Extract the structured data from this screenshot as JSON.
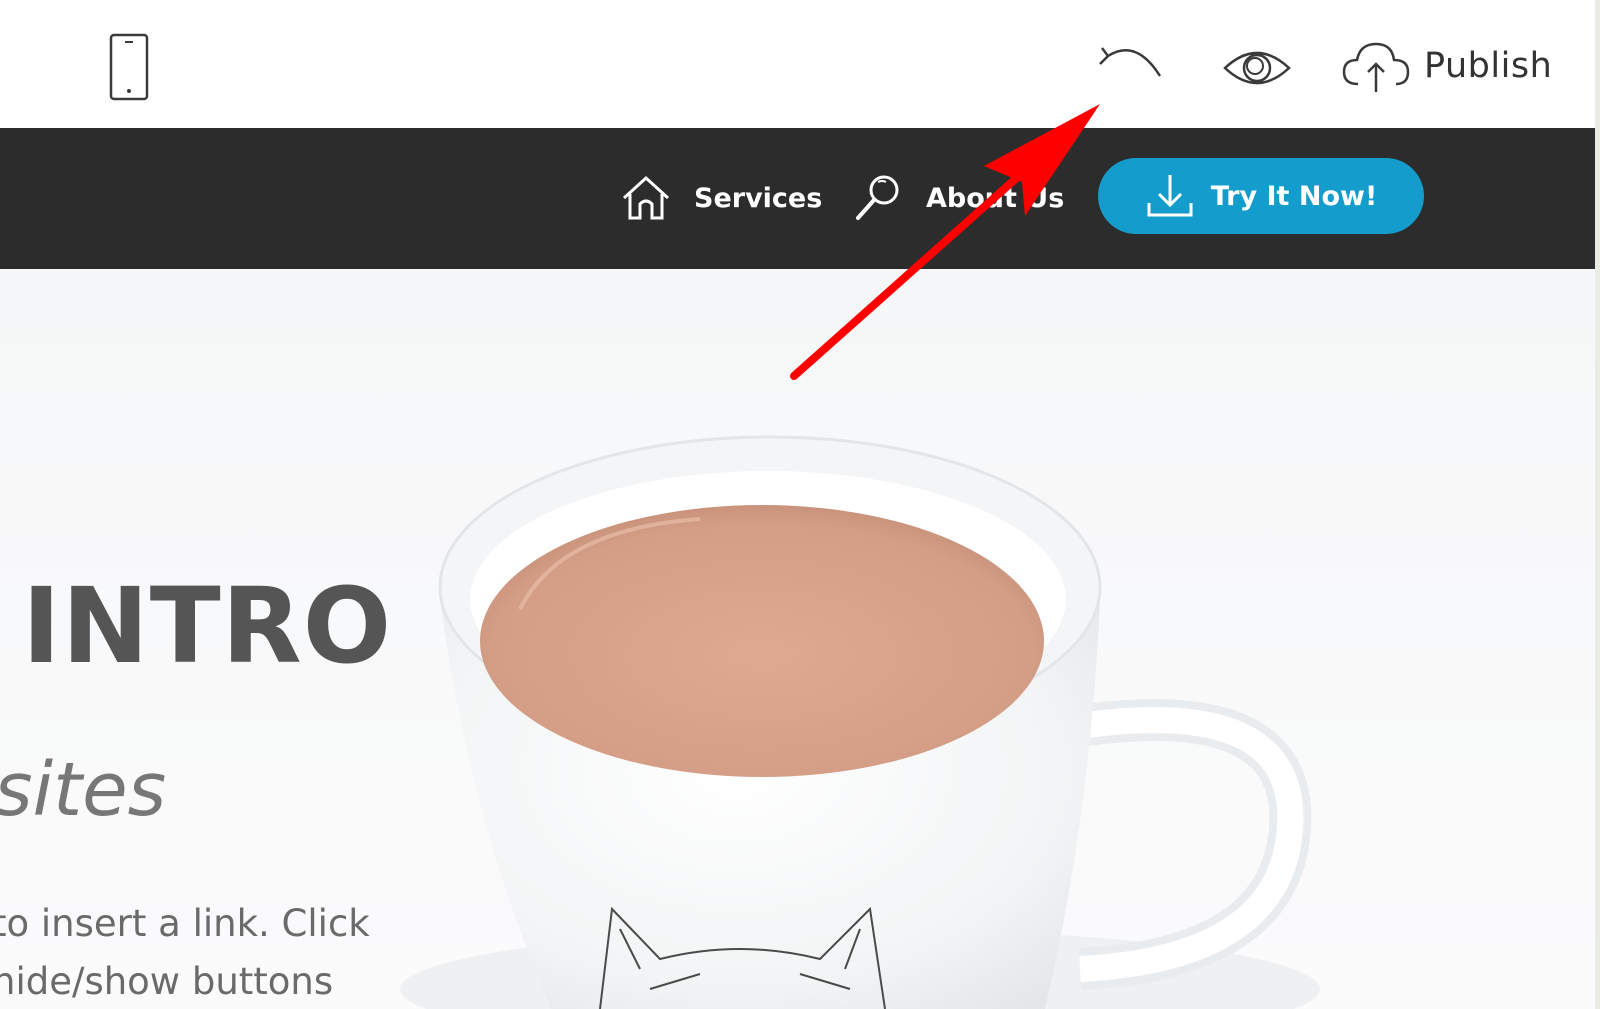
{
  "toolbar": {
    "icons": {
      "mobile": "mobile-phone-icon",
      "undo": "undo-icon",
      "preview": "eye-icon",
      "publish": "cloud-upload-icon"
    },
    "publish_label": "Publish"
  },
  "nav": {
    "items": [
      {
        "label": "Services",
        "icon": "home-icon"
      },
      {
        "label": "About Us",
        "icon": "search-icon"
      }
    ],
    "cta": {
      "label": "Try It Now!",
      "icon": "download-icon"
    }
  },
  "hero": {
    "title": "INTRO",
    "subtitle": "sites",
    "text_lines": [
      "to insert a link. Click",
      "hide/show buttons"
    ]
  },
  "colors": {
    "nav_bg": "#2c2c2c",
    "cta_bg": "#149dcc",
    "annotation": "#ff0000",
    "coffee": "#d9a78f"
  }
}
